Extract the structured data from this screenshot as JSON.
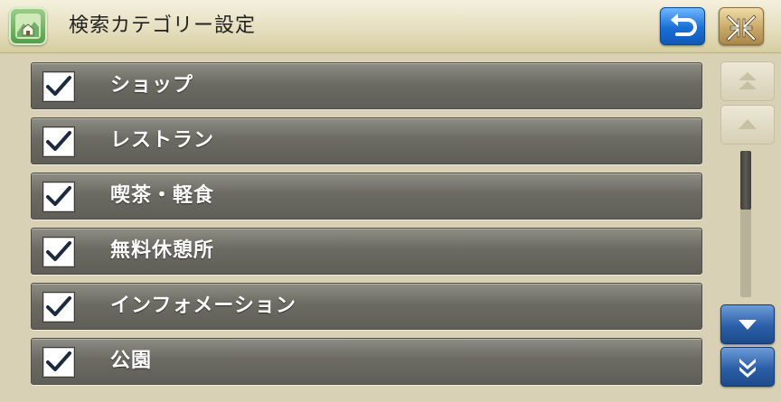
{
  "header": {
    "title": "検索カテゴリー設定",
    "app_icon": "map-home-icon",
    "back_icon": "return-arrow-icon",
    "collapse_icon": "shrink-arrows-icon"
  },
  "categories": [
    {
      "label": "ショップ",
      "checked": true
    },
    {
      "label": "レストラン",
      "checked": true
    },
    {
      "label": "喫茶・軽食",
      "checked": true
    },
    {
      "label": "無料休憩所",
      "checked": true
    },
    {
      "label": "インフォメーション",
      "checked": true
    },
    {
      "label": "公園",
      "checked": true
    }
  ],
  "scroll": {
    "page_up_icon": "double-chevron-up-icon",
    "line_up_icon": "triangle-up-icon",
    "line_down_icon": "triangle-down-icon",
    "page_down_icon": "double-chevron-down-icon",
    "up_enabled": false,
    "down_enabled": true,
    "position_fraction": 0.0,
    "visible_fraction": 0.4
  },
  "colors": {
    "back_button": "#1a6fd6",
    "collapse_button": "#c9a866",
    "row_background": "#6c6b63",
    "check_mark": "#1b2a3f"
  }
}
